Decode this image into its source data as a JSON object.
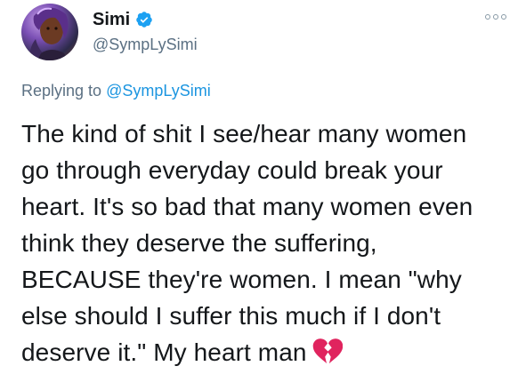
{
  "author": {
    "display_name": "Simi",
    "handle": "@SympLySimi",
    "verified": true
  },
  "reply_context": {
    "prefix": "Replying to ",
    "mention": "@SympLySimi"
  },
  "tweet": {
    "lines": [
      "The kind of shit I see/hear many women",
      "go through everyday could break your",
      "heart. It's so bad that many women even",
      "think they deserve the suffering,",
      "BECAUSE they're women. I mean \"why",
      "else should I suffer this much if I don't",
      "deserve it.\" My heart man"
    ],
    "trailing_emoji": "broken-heart-icon"
  },
  "colors": {
    "text_primary": "#14171a",
    "text_secondary": "#5b7083",
    "link": "#1b95e0",
    "verified_badge": "#1da1f2",
    "heart": "#e0245e"
  },
  "icons": [
    "verified-badge-icon",
    "more-options-icon",
    "broken-heart-icon"
  ]
}
